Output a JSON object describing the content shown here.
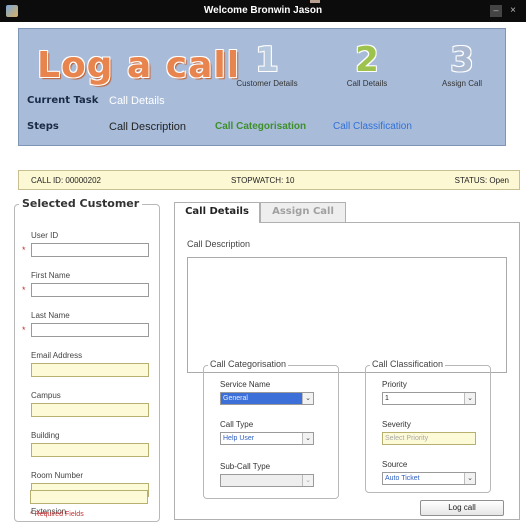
{
  "window": {
    "title": "Welcome Bronwin Jason"
  },
  "header": {
    "logo": "Log a call",
    "steps": [
      {
        "number": "1",
        "label": "Customer Details"
      },
      {
        "number": "2",
        "label": "Call Details"
      },
      {
        "number": "3",
        "label": "Assign Call"
      }
    ],
    "current_task_label": "Current Task",
    "current_task_value": "Call Details",
    "steps_label": "Steps",
    "step_items": [
      "Call Description",
      "Call Categorisation",
      "Call Classification"
    ]
  },
  "infobar": {
    "call_id": "CALL ID:  00000202",
    "stopwatch": "STOPWATCH:  10",
    "status": "STATUS: Open"
  },
  "customer": {
    "title": "Selected Customer",
    "fields": [
      {
        "label": "User ID",
        "required": true
      },
      {
        "label": "First Name",
        "required": true
      },
      {
        "label": "Last Name",
        "required": true
      },
      {
        "label": "Email Address",
        "required": false
      },
      {
        "label": "Campus",
        "required": false
      },
      {
        "label": "Building",
        "required": false
      },
      {
        "label": "Room Number",
        "required": false
      },
      {
        "label": "Extension",
        "required": false
      }
    ],
    "required_note": "* Required Fields",
    "required_mark": "*"
  },
  "tabs": {
    "active": "Call Details",
    "inactive": "Assign Call"
  },
  "call_details": {
    "description_label": "Call Description",
    "categorisation": {
      "title": "Call Categorisation",
      "service_name_label": "Service Name",
      "service_name_value": "General",
      "call_type_label": "Call Type",
      "call_type_value": "Help User",
      "sub_call_type_label": "Sub-Call Type",
      "sub_call_type_value": ""
    },
    "classification": {
      "title": "Call Classification",
      "priority_label": "Priority",
      "priority_value": "1",
      "severity_label": "Severity",
      "severity_placeholder": "Select Priority",
      "source_label": "Source",
      "source_value": "Auto Ticket"
    },
    "log_button": "Log call"
  },
  "icons": {
    "dropdown": "chevron-down-icon",
    "close": "close-icon",
    "minimize": "minimize-icon"
  }
}
